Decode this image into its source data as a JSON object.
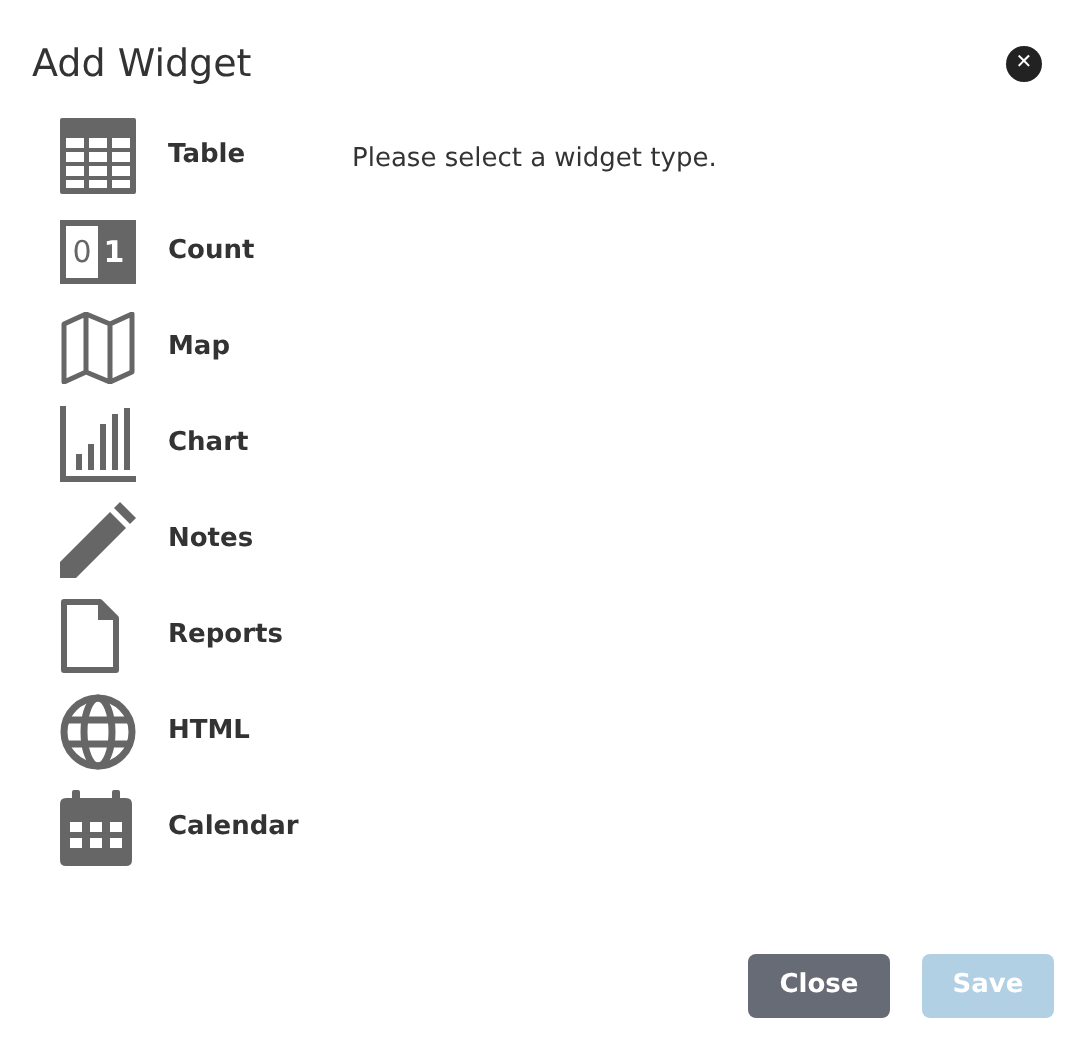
{
  "dialog": {
    "title": "Add Widget",
    "close_symbol": "✕"
  },
  "widget_types": [
    {
      "kind": "table",
      "label": "Table"
    },
    {
      "kind": "count",
      "label": "Count",
      "icon_digits": [
        "0",
        "1"
      ]
    },
    {
      "kind": "map",
      "label": "Map"
    },
    {
      "kind": "chart",
      "label": "Chart"
    },
    {
      "kind": "notes",
      "label": "Notes"
    },
    {
      "kind": "reports",
      "label": "Reports"
    },
    {
      "kind": "html",
      "label": "HTML"
    },
    {
      "kind": "calendar",
      "label": "Calendar"
    }
  ],
  "message": "Please select a widget type.",
  "buttons": [
    {
      "kind": "close",
      "label": "Close",
      "disabled": false
    },
    {
      "kind": "save",
      "label": "Save",
      "disabled": true
    }
  ]
}
